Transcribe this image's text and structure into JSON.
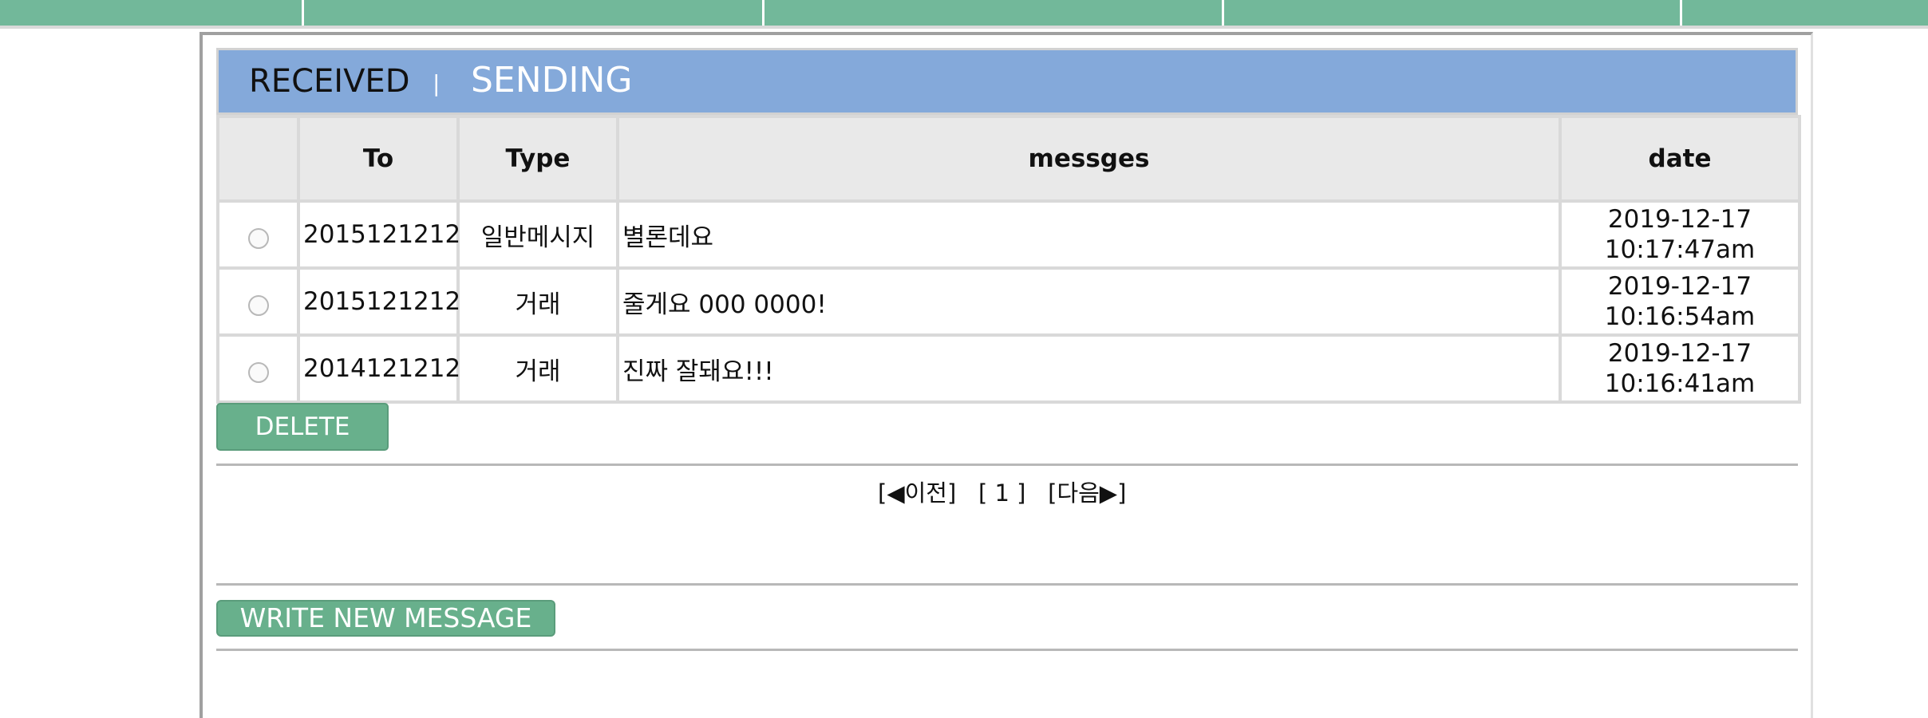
{
  "tabs": {
    "received": "RECEIVED",
    "divider": "|",
    "sending": "SENDING"
  },
  "table": {
    "headers": {
      "check": "",
      "to": "To",
      "type": "Type",
      "messages": "messges",
      "date": "date"
    },
    "rows": [
      {
        "to": "2015121212",
        "type": "일반메시지",
        "message": "별론데요",
        "date_line1": "2019-12-17",
        "date_line2": "10:17:47am"
      },
      {
        "to": "2015121212",
        "type": "거래",
        "message": "줄게요 000 0000!",
        "date_line1": "2019-12-17",
        "date_line2": "10:16:54am"
      },
      {
        "to": "2014121212",
        "type": "거래",
        "message": "진짜 잘돼요!!!",
        "date_line1": "2019-12-17",
        "date_line2": "10:16:41am"
      }
    ]
  },
  "actions": {
    "delete_label": "DELETE",
    "write_label": "WRITE NEW MESSAGE"
  },
  "pagination": {
    "prev": "[◀이전]",
    "current": "[ 1 ]",
    "next": "[다음▶]"
  },
  "colors": {
    "nav": "#72b89a",
    "header": "#84a9da",
    "button": "#68b08c"
  }
}
